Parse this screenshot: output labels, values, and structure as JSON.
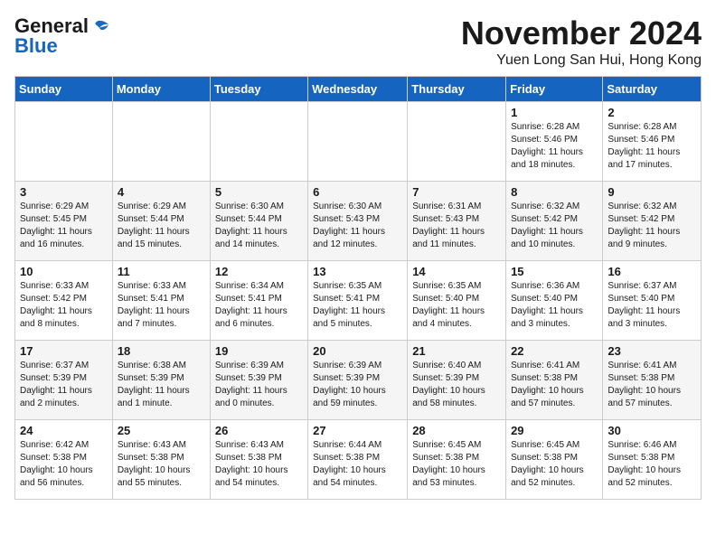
{
  "header": {
    "logo_general": "General",
    "logo_blue": "Blue",
    "month_title": "November 2024",
    "location": "Yuen Long San Hui, Hong Kong"
  },
  "weekdays": [
    "Sunday",
    "Monday",
    "Tuesday",
    "Wednesday",
    "Thursday",
    "Friday",
    "Saturday"
  ],
  "weeks": [
    [
      {
        "day": "",
        "info": ""
      },
      {
        "day": "",
        "info": ""
      },
      {
        "day": "",
        "info": ""
      },
      {
        "day": "",
        "info": ""
      },
      {
        "day": "",
        "info": ""
      },
      {
        "day": "1",
        "info": "Sunrise: 6:28 AM\nSunset: 5:46 PM\nDaylight: 11 hours\nand 18 minutes."
      },
      {
        "day": "2",
        "info": "Sunrise: 6:28 AM\nSunset: 5:46 PM\nDaylight: 11 hours\nand 17 minutes."
      }
    ],
    [
      {
        "day": "3",
        "info": "Sunrise: 6:29 AM\nSunset: 5:45 PM\nDaylight: 11 hours\nand 16 minutes."
      },
      {
        "day": "4",
        "info": "Sunrise: 6:29 AM\nSunset: 5:44 PM\nDaylight: 11 hours\nand 15 minutes."
      },
      {
        "day": "5",
        "info": "Sunrise: 6:30 AM\nSunset: 5:44 PM\nDaylight: 11 hours\nand 14 minutes."
      },
      {
        "day": "6",
        "info": "Sunrise: 6:30 AM\nSunset: 5:43 PM\nDaylight: 11 hours\nand 12 minutes."
      },
      {
        "day": "7",
        "info": "Sunrise: 6:31 AM\nSunset: 5:43 PM\nDaylight: 11 hours\nand 11 minutes."
      },
      {
        "day": "8",
        "info": "Sunrise: 6:32 AM\nSunset: 5:42 PM\nDaylight: 11 hours\nand 10 minutes."
      },
      {
        "day": "9",
        "info": "Sunrise: 6:32 AM\nSunset: 5:42 PM\nDaylight: 11 hours\nand 9 minutes."
      }
    ],
    [
      {
        "day": "10",
        "info": "Sunrise: 6:33 AM\nSunset: 5:42 PM\nDaylight: 11 hours\nand 8 minutes."
      },
      {
        "day": "11",
        "info": "Sunrise: 6:33 AM\nSunset: 5:41 PM\nDaylight: 11 hours\nand 7 minutes."
      },
      {
        "day": "12",
        "info": "Sunrise: 6:34 AM\nSunset: 5:41 PM\nDaylight: 11 hours\nand 6 minutes."
      },
      {
        "day": "13",
        "info": "Sunrise: 6:35 AM\nSunset: 5:41 PM\nDaylight: 11 hours\nand 5 minutes."
      },
      {
        "day": "14",
        "info": "Sunrise: 6:35 AM\nSunset: 5:40 PM\nDaylight: 11 hours\nand 4 minutes."
      },
      {
        "day": "15",
        "info": "Sunrise: 6:36 AM\nSunset: 5:40 PM\nDaylight: 11 hours\nand 3 minutes."
      },
      {
        "day": "16",
        "info": "Sunrise: 6:37 AM\nSunset: 5:40 PM\nDaylight: 11 hours\nand 3 minutes."
      }
    ],
    [
      {
        "day": "17",
        "info": "Sunrise: 6:37 AM\nSunset: 5:39 PM\nDaylight: 11 hours\nand 2 minutes."
      },
      {
        "day": "18",
        "info": "Sunrise: 6:38 AM\nSunset: 5:39 PM\nDaylight: 11 hours\nand 1 minute."
      },
      {
        "day": "19",
        "info": "Sunrise: 6:39 AM\nSunset: 5:39 PM\nDaylight: 11 hours\nand 0 minutes."
      },
      {
        "day": "20",
        "info": "Sunrise: 6:39 AM\nSunset: 5:39 PM\nDaylight: 10 hours\nand 59 minutes."
      },
      {
        "day": "21",
        "info": "Sunrise: 6:40 AM\nSunset: 5:39 PM\nDaylight: 10 hours\nand 58 minutes."
      },
      {
        "day": "22",
        "info": "Sunrise: 6:41 AM\nSunset: 5:38 PM\nDaylight: 10 hours\nand 57 minutes."
      },
      {
        "day": "23",
        "info": "Sunrise: 6:41 AM\nSunset: 5:38 PM\nDaylight: 10 hours\nand 57 minutes."
      }
    ],
    [
      {
        "day": "24",
        "info": "Sunrise: 6:42 AM\nSunset: 5:38 PM\nDaylight: 10 hours\nand 56 minutes."
      },
      {
        "day": "25",
        "info": "Sunrise: 6:43 AM\nSunset: 5:38 PM\nDaylight: 10 hours\nand 55 minutes."
      },
      {
        "day": "26",
        "info": "Sunrise: 6:43 AM\nSunset: 5:38 PM\nDaylight: 10 hours\nand 54 minutes."
      },
      {
        "day": "27",
        "info": "Sunrise: 6:44 AM\nSunset: 5:38 PM\nDaylight: 10 hours\nand 54 minutes."
      },
      {
        "day": "28",
        "info": "Sunrise: 6:45 AM\nSunset: 5:38 PM\nDaylight: 10 hours\nand 53 minutes."
      },
      {
        "day": "29",
        "info": "Sunrise: 6:45 AM\nSunset: 5:38 PM\nDaylight: 10 hours\nand 52 minutes."
      },
      {
        "day": "30",
        "info": "Sunrise: 6:46 AM\nSunset: 5:38 PM\nDaylight: 10 hours\nand 52 minutes."
      }
    ]
  ]
}
